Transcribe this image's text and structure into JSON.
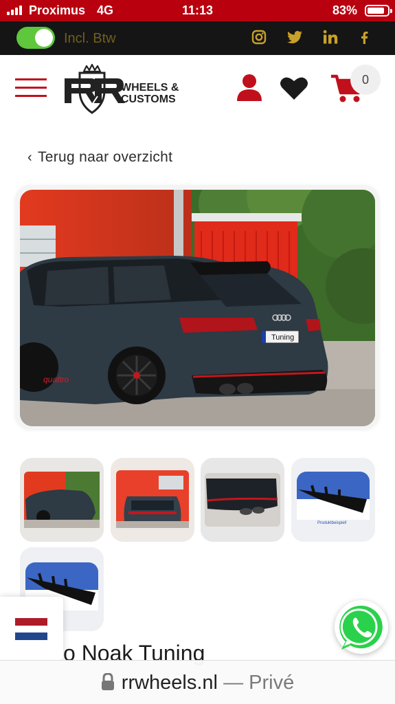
{
  "status_bar": {
    "carrier": "Proximus",
    "network": "4G",
    "time": "11:13",
    "battery": "83%"
  },
  "top_bar": {
    "toggle_on": true,
    "toggle_label": "Incl. Btw",
    "social": [
      "instagram-icon",
      "twitter-icon",
      "linkedin-icon",
      "facebook-icon"
    ],
    "accent_color": "#c8a12a"
  },
  "header": {
    "logo_text_line1": "WHEELS &",
    "logo_text_line2": "CUSTOMS",
    "cart_count": "0",
    "brand_color": "#c0101c"
  },
  "back_link": "Terug naar overzicht",
  "main_image": {
    "badge_text": "quattro",
    "plate_text": "Tuning"
  },
  "product": {
    "title_visible": "o Noak Tuning"
  },
  "language": {
    "flag": "NL"
  },
  "browser": {
    "domain": "rrwheels.nl",
    "mode": "— Privé"
  }
}
